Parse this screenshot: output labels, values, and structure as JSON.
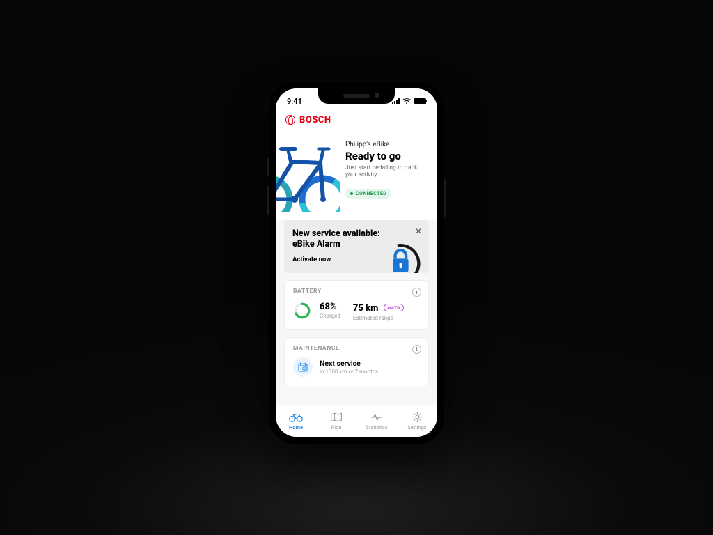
{
  "status_bar": {
    "time": "9:41"
  },
  "brand": {
    "name": "BOSCH"
  },
  "hero": {
    "owner": "Philipp's eBike",
    "headline": "Ready to go",
    "sub": "Just start pedalling to track your activity",
    "connection_badge": "CONNECTED"
  },
  "promo": {
    "title_line1": "New service available:",
    "title_line2": "eBike Alarm",
    "cta": "Activate now"
  },
  "battery": {
    "section_label": "BATTERY",
    "percent_value": "68%",
    "percent_label": "Charged",
    "range_value": "75 km",
    "range_label": "Estimated range",
    "mode": "eMTB",
    "charge_fraction": 0.68
  },
  "maintenance": {
    "section_label": "MAINTENANCE",
    "title": "Next service",
    "detail": "in 1360 km or 7 months"
  },
  "tabs": {
    "home": "Home",
    "ride": "Ride",
    "statistics": "Statistics",
    "settings": "Settings"
  },
  "colors": {
    "brand_red": "#E20015",
    "accent_blue": "#1e88e5",
    "success_green": "#1a9c4b",
    "mode_purple": "#c44bdc"
  }
}
